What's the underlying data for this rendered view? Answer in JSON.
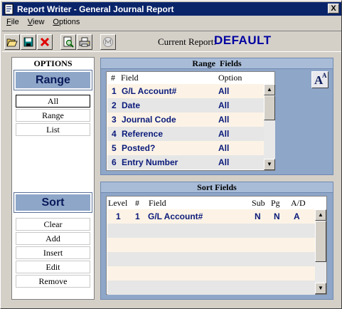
{
  "window": {
    "title": "Report Writer - General Journal Report",
    "close_glyph": "X"
  },
  "menu": {
    "items": [
      {
        "label": "File",
        "underline": "F",
        "rest": "ile"
      },
      {
        "label": "View",
        "underline": "V",
        "rest": "iew"
      },
      {
        "label": "Options",
        "underline": "O",
        "rest": "ptions"
      }
    ]
  },
  "toolbar": {
    "buttons": [
      "open-folder-icon",
      "save-disk-icon",
      "delete-x-icon",
      "print-preview-icon",
      "print-icon",
      "m-disabled-icon"
    ],
    "current_report_label": "Current Report:",
    "current_report_value": "DEFAULT"
  },
  "options_panel": {
    "title": "OPTIONS",
    "range_header": "Range",
    "range_buttons": [
      "All",
      "Range",
      "List"
    ],
    "selected_range": "All",
    "sort_header": "Sort",
    "sort_buttons": [
      "Clear",
      "Add",
      "Insert",
      "Edit",
      "Remove"
    ]
  },
  "range_fields": {
    "title": "Range  Fields",
    "columns": {
      "num": "#",
      "field": "Field",
      "option": "Option"
    },
    "rows": [
      {
        "num": "1",
        "field": "G/L Account#",
        "option": "All"
      },
      {
        "num": "2",
        "field": "Date",
        "option": "All"
      },
      {
        "num": "3",
        "field": "Journal Code",
        "option": "All"
      },
      {
        "num": "4",
        "field": "Reference",
        "option": "All"
      },
      {
        "num": "5",
        "field": "Posted?",
        "option": "All"
      },
      {
        "num": "6",
        "field": "Entry Number",
        "option": "All"
      }
    ],
    "font_button": {
      "big": "A",
      "small": "A"
    }
  },
  "sort_fields": {
    "title": "Sort Fields",
    "columns": {
      "level": "Level",
      "num": "#",
      "field": "Field",
      "sub": "Sub",
      "pg": "Pg",
      "ad": "A/D"
    },
    "rows": [
      {
        "level": "1",
        "num": "1",
        "field": "G/L Account#",
        "sub": "N",
        "pg": "N",
        "ad": "A"
      }
    ],
    "empty_rows": 5
  },
  "colors": {
    "title_bar": "#0a246a",
    "panel_blue": "#8ea6c8",
    "row_odd": "#fcf3e6",
    "row_even": "#e6e6e6",
    "data_text": "#0a1a7a",
    "current_report": "#0000a0"
  }
}
